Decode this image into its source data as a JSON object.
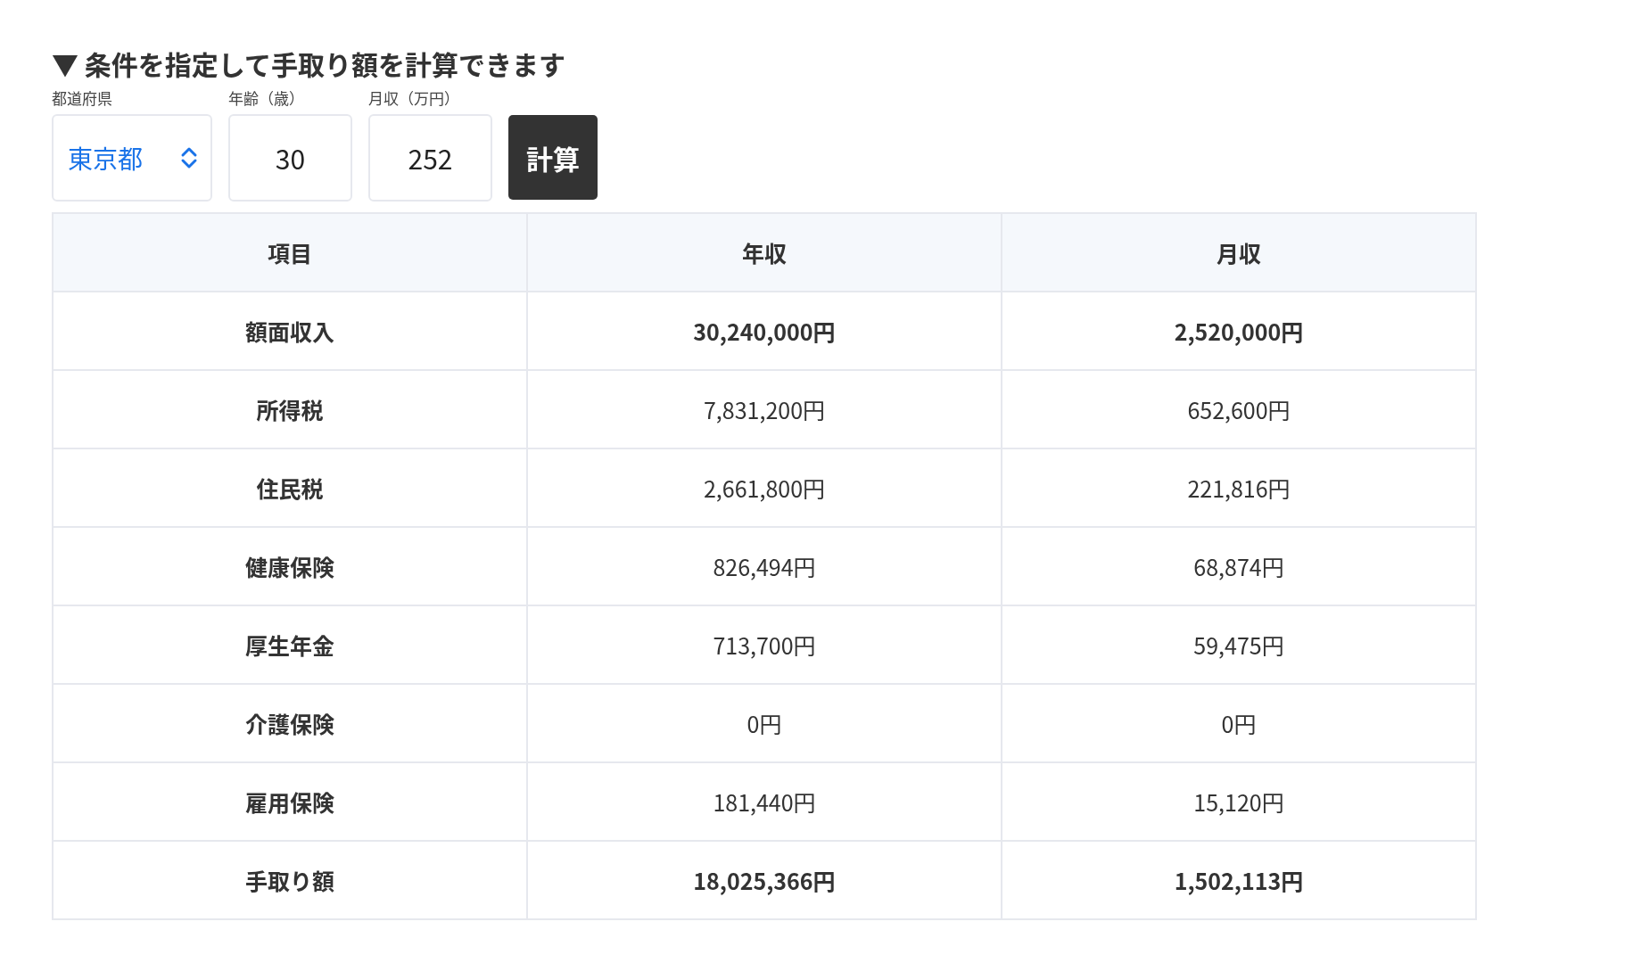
{
  "heading": "▼ 条件を指定して手取り額を計算できます",
  "form": {
    "prefecture": {
      "label": "都道府県",
      "value": "東京都"
    },
    "age": {
      "label": "年齢（歳）",
      "value": "30"
    },
    "monthly": {
      "label": "月収（万円）",
      "value": "252"
    },
    "button": "計算"
  },
  "table": {
    "columns": [
      "項目",
      "年収",
      "月収"
    ],
    "rows": [
      {
        "item": "額面収入",
        "annual": "30,240,000円",
        "monthly": "2,520,000円",
        "bold": true
      },
      {
        "item": "所得税",
        "annual": "7,831,200円",
        "monthly": "652,600円",
        "bold": false
      },
      {
        "item": "住民税",
        "annual": "2,661,800円",
        "monthly": "221,816円",
        "bold": false
      },
      {
        "item": "健康保険",
        "annual": "826,494円",
        "monthly": "68,874円",
        "bold": false
      },
      {
        "item": "厚生年金",
        "annual": "713,700円",
        "monthly": "59,475円",
        "bold": false
      },
      {
        "item": "介護保険",
        "annual": "0円",
        "monthly": "0円",
        "bold": false
      },
      {
        "item": "雇用保険",
        "annual": "181,440円",
        "monthly": "15,120円",
        "bold": false
      },
      {
        "item": "手取り額",
        "annual": "18,025,366円",
        "monthly": "1,502,113円",
        "bold": true
      }
    ]
  }
}
